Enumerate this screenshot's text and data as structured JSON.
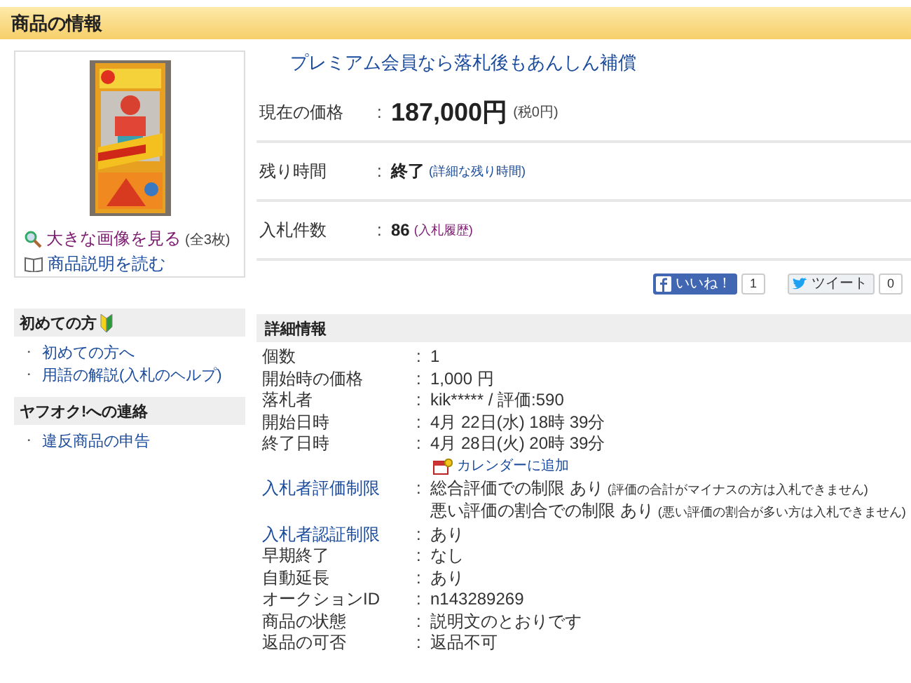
{
  "header": {
    "title": "商品の情報"
  },
  "item": {
    "links": [
      {
        "kind": "zoom",
        "text": "大きな画像を見る",
        "note": "(全3枚)"
      },
      {
        "kind": "book",
        "text": "商品説明を読む"
      }
    ]
  },
  "promo": "プレミアム会員なら落札後もあんしん補償",
  "summary": [
    {
      "kind": "price",
      "label": "現在の価格",
      "value": "187,000円",
      "note": "(税0円)"
    },
    {
      "kind": "time",
      "label": "残り時間",
      "value": "終了",
      "note": "(詳細な残り時間)"
    },
    {
      "kind": "bids",
      "label": "入札件数",
      "value": "86",
      "note": "(入札履歴)"
    }
  ],
  "social": [
    {
      "kind": "facebook",
      "label": "いいね！",
      "count": "1"
    },
    {
      "kind": "twitter",
      "label": "ツイート",
      "count": "0"
    }
  ],
  "separator": ":",
  "sidebar_bullet": "・",
  "sidebar": [
    {
      "title": "初めての方",
      "beginner_mark": true,
      "links": [
        "初めての方へ",
        "用語の解説(入札のヘルプ)"
      ]
    },
    {
      "title": "ヤフオク!への連絡",
      "beginner_mark": false,
      "links": [
        "違反商品の申告"
      ]
    }
  ],
  "details": {
    "title": "詳細情報",
    "rows": [
      {
        "label": "個数",
        "kind": "plain",
        "values": [
          {
            "text": "1"
          }
        ]
      },
      {
        "label": "開始時の価格",
        "kind": "plain",
        "values": [
          {
            "text": "1,000 円"
          }
        ]
      },
      {
        "label": "落札者",
        "kind": "plain",
        "values": [
          {
            "text": "kik***** / 評価:590"
          }
        ]
      },
      {
        "label": "開始日時",
        "kind": "plain",
        "values": [
          {
            "text": "4月 22日(水) 18時 39分"
          }
        ]
      },
      {
        "label": "終了日時",
        "kind": "plain",
        "values": [
          {
            "text": "4月 28日(火) 20時 39分"
          }
        ],
        "calendar_link": "カレンダーに追加"
      },
      {
        "label": "入札者評価制限",
        "kind": "link",
        "values": [
          {
            "text": "総合評価での制限 あり",
            "note": "(評価の合計がマイナスの方は入札できません)"
          },
          {
            "text": "悪い評価の割合での制限 あり",
            "note": "(悪い評価の割合が多い方は入札できません)"
          }
        ]
      },
      {
        "label": "入札者認証制限",
        "kind": "link",
        "values": [
          {
            "text": "あり"
          }
        ]
      },
      {
        "label": "早期終了",
        "kind": "plain",
        "values": [
          {
            "text": "なし"
          }
        ]
      },
      {
        "label": "自動延長",
        "kind": "plain",
        "values": [
          {
            "text": "あり"
          }
        ]
      },
      {
        "label": "オークションID",
        "kind": "plain",
        "values": [
          {
            "text": "n143289269"
          }
        ]
      },
      {
        "label": "商品の状態",
        "kind": "plain",
        "values": [
          {
            "text": "説明文のとおりです"
          }
        ]
      },
      {
        "label": "返品の可否",
        "kind": "plain",
        "values": [
          {
            "text": "返品不可"
          }
        ]
      }
    ]
  }
}
